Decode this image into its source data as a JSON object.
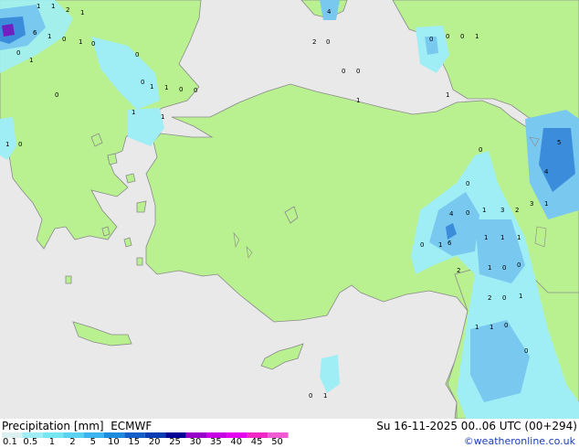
{
  "header": {
    "product": "Precipitation [mm]",
    "model": "ECMWF",
    "valid": "Su 16-11-2025 00..06 UTC (00+294)"
  },
  "footer": {
    "copyright": "©weatheronline.co.uk"
  },
  "legend": {
    "values": [
      "0.1",
      "0.5",
      "1",
      "2",
      "5",
      "10",
      "15",
      "20",
      "25",
      "30",
      "35",
      "40",
      "45",
      "50"
    ],
    "colors": [
      "#dcf0f0",
      "#a0eef5",
      "#78e6f0",
      "#5ad2f0",
      "#3cb4f0",
      "#1e8cdc",
      "#1460c8",
      "#0a3cb4",
      "#000096",
      "#9600c8",
      "#c800e6",
      "#e600f0",
      "#f028c8",
      "#f05ad2"
    ]
  },
  "map": {
    "colors": {
      "sea": "#e9e9e9",
      "land": "#b9f090",
      "coast": "#8a8a8a",
      "precip_light": "#a0eef5",
      "precip_mid": "#78c8f0",
      "precip_strong": "#3c8cdc"
    },
    "labels": [
      "1",
      "1",
      "2",
      "1",
      "6",
      "0",
      "1",
      "0",
      "0",
      "1",
      "1",
      "1",
      "0",
      "0",
      "0",
      "1",
      "1",
      "0",
      "1",
      "0",
      "1",
      "0",
      "4",
      "2",
      "0",
      "0",
      "0",
      "1",
      "0",
      "0",
      "0",
      "1",
      "5",
      "4",
      "0",
      "1",
      "3",
      "1",
      "0",
      "1",
      "3",
      "2",
      "0",
      "4",
      "6",
      "0",
      "1",
      "1",
      "1",
      "1",
      "1",
      "0",
      "0",
      "2",
      "2",
      "0",
      "1",
      "1",
      "1",
      "0",
      "0",
      "1",
      "0"
    ]
  }
}
